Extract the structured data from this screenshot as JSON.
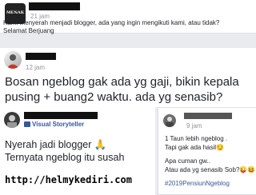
{
  "post1": {
    "avatar_label": "MENAK",
    "time": "21 jam",
    "text": "Kami menyerah menjadi blogger, ada yang ingin mengikuti kami, atau tidak?\nSelamat Berjuang"
  },
  "post2": {
    "time": "12 jam",
    "text": "Bosan ngeblog gak ada yg gaji, bikin kepala pusing + buang2 waktu. ada yg senasib?"
  },
  "post3": {
    "badge": "Visual Storyteller",
    "text": "Nyerah jadi blogger 🙏\nTernyata ngeblog itu susah"
  },
  "post4": {
    "time": "9 jam",
    "line1": "1 Taun lebih ngeblog .",
    "line2": "Tapi gak ada hasil😏",
    "line3": "Apa cuman gw..",
    "line4": "Atau ada yg senasib Sob?😜😆",
    "hashtag": "#2019PensiunNgeblog"
  },
  "watermark": "http://helmykediri.com"
}
